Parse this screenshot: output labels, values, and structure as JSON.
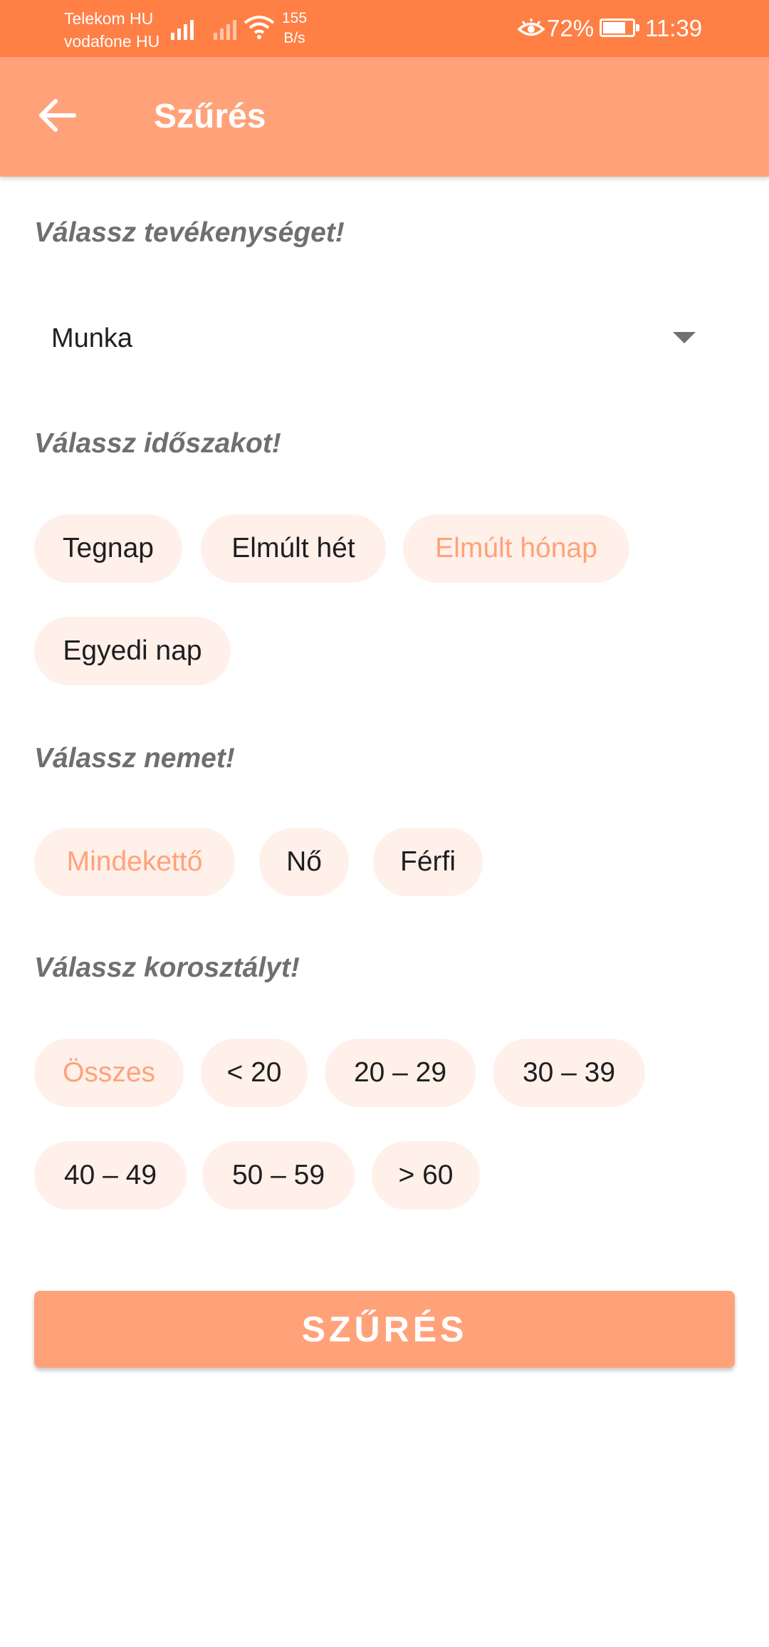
{
  "status_bar": {
    "carrier_1": "Telekom HU",
    "carrier_2": "vodafone HU",
    "net_speed_value": "155",
    "net_speed_unit": "B/s",
    "battery_percent": "72%",
    "battery_level": 0.72,
    "time": "11:39",
    "icons": [
      "signal-icon",
      "wifi-icon",
      "eye-icon",
      "battery-icon"
    ]
  },
  "app_bar": {
    "title": "Szűrés",
    "back_icon": "arrow-left-icon"
  },
  "activity": {
    "label": "Válassz tevékenységet!",
    "selected": "Munka"
  },
  "period": {
    "label": "Válassz időszakot!",
    "options": [
      "Tegnap",
      "Elmúlt hét",
      "Elmúlt hónap",
      "Egyedi nap"
    ],
    "selected": "Elmúlt hónap"
  },
  "gender": {
    "label": "Válassz nemet!",
    "options": [
      "Mindekettő",
      "Nő",
      "Férfi"
    ],
    "selected": "Mindekettő"
  },
  "age": {
    "label": "Válassz korosztályt!",
    "options": [
      "Összes",
      "< 20",
      "20 – 29",
      "30 – 39",
      "40 – 49",
      "50 – 59",
      "> 60"
    ],
    "selected": "Összes"
  },
  "filter_button": "SZŰRÉS",
  "colors": {
    "status_bar": "#FF7F45",
    "accent": "#FFA27A",
    "chip_bg": "#FFF0EA",
    "label_text": "#6F6F6F"
  }
}
